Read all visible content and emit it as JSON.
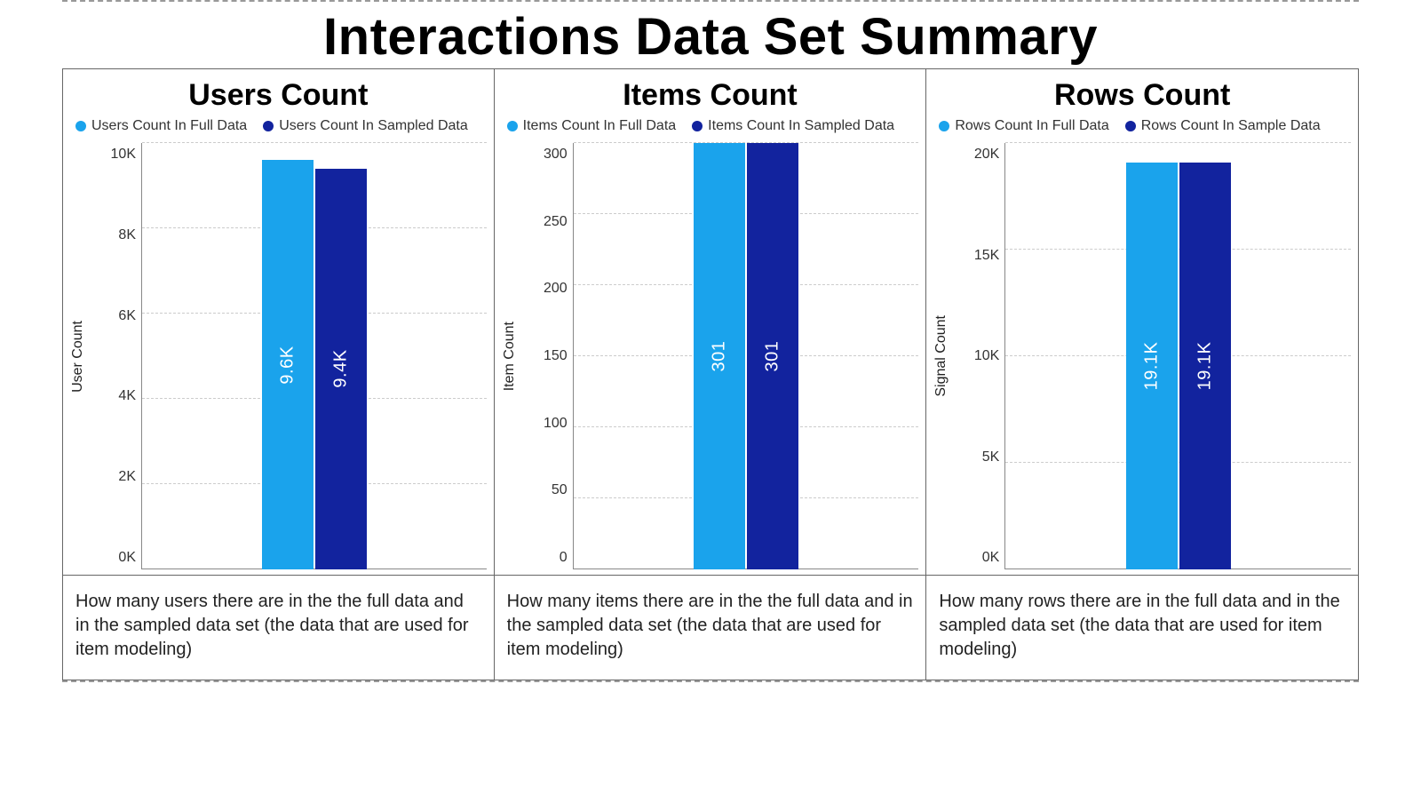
{
  "title": "Interactions Data Set Summary",
  "colors": {
    "light": "#1aa3ec",
    "dark": "#12239e"
  },
  "panels": [
    {
      "title": "Users Count",
      "ylabel": "User Count",
      "legend": [
        "Users Count In Full Data",
        "Users Count In Sampled Data"
      ],
      "ticks": [
        "10K",
        "8K",
        "6K",
        "4K",
        "2K",
        "0K"
      ],
      "description": "How many users there are in the the full data and in the sampled data set (the data that are used for item modeling)"
    },
    {
      "title": "Items Count",
      "ylabel": "Item Count",
      "legend": [
        "Items Count In Full Data",
        "Items Count In Sampled Data"
      ],
      "ticks": [
        "300",
        "250",
        "200",
        "150",
        "100",
        "50",
        "0"
      ],
      "description": "How many items there are in the the full data and in the sampled data set (the data that are used for item modeling)"
    },
    {
      "title": "Rows Count",
      "ylabel": "Signal Count",
      "legend": [
        "Rows Count In Full Data",
        "Rows Count In Sample Data"
      ],
      "ticks": [
        "20K",
        "15K",
        "10K",
        "5K",
        "0K"
      ],
      "description": "How many rows there are in the full data  and in the sampled data set (the data that are used for item modeling)"
    }
  ],
  "chart_data": [
    {
      "type": "bar",
      "title": "Users Count",
      "ylabel": "User Count",
      "ylim": [
        0,
        10000
      ],
      "yticks": [
        0,
        2000,
        4000,
        6000,
        8000,
        10000
      ],
      "series": [
        {
          "name": "Users Count In Full Data",
          "value": 9600,
          "label": "9.6K",
          "color": "#1aa3ec"
        },
        {
          "name": "Users Count In Sampled Data",
          "value": 9400,
          "label": "9.4K",
          "color": "#12239e"
        }
      ]
    },
    {
      "type": "bar",
      "title": "Items Count",
      "ylabel": "Item Count",
      "ylim": [
        0,
        300
      ],
      "yticks": [
        0,
        50,
        100,
        150,
        200,
        250,
        300
      ],
      "series": [
        {
          "name": "Items Count In Full Data",
          "value": 301,
          "label": "301",
          "color": "#1aa3ec"
        },
        {
          "name": "Items Count In Sampled Data",
          "value": 301,
          "label": "301",
          "color": "#12239e"
        }
      ]
    },
    {
      "type": "bar",
      "title": "Rows Count",
      "ylabel": "Signal Count",
      "ylim": [
        0,
        20000
      ],
      "yticks": [
        0,
        5000,
        10000,
        15000,
        20000
      ],
      "series": [
        {
          "name": "Rows Count In Full Data",
          "value": 19100,
          "label": "19.1K",
          "color": "#1aa3ec"
        },
        {
          "name": "Rows Count In Sample Data",
          "value": 19100,
          "label": "19.1K",
          "color": "#12239e"
        }
      ]
    }
  ]
}
